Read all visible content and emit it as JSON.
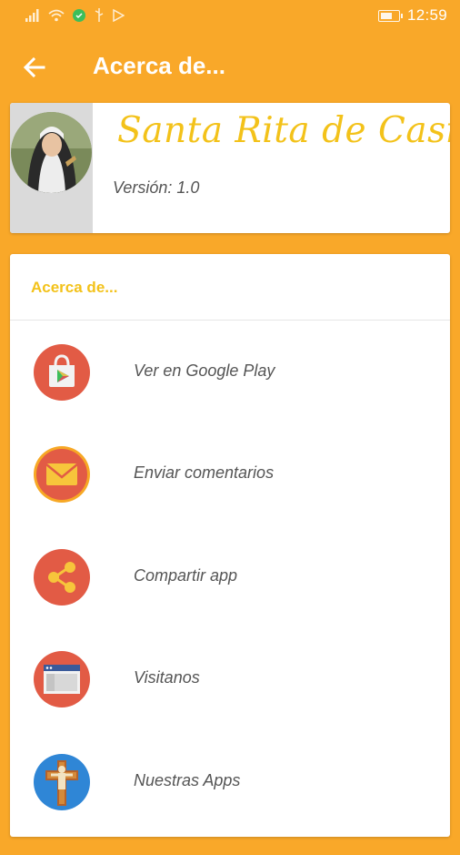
{
  "status_bar": {
    "time": "12:59"
  },
  "app_bar": {
    "title": "Acerca de..."
  },
  "header": {
    "app_name": "Santa Rita de Casia",
    "version": "Versión: 1.0"
  },
  "menu": {
    "section_title": "Acerca de...",
    "items": [
      {
        "label": "Ver en Google Play",
        "icon": "google-play-icon"
      },
      {
        "label": "Enviar comentarios",
        "icon": "envelope-icon"
      },
      {
        "label": "Compartir app",
        "icon": "share-icon"
      },
      {
        "label": "Visitanos",
        "icon": "browser-window-icon"
      },
      {
        "label": "Nuestras Apps",
        "icon": "crucifix-icon"
      }
    ]
  },
  "colors": {
    "primary": "#F9A829",
    "accent": "#F3C21A",
    "icon_red": "#E25B45",
    "icon_blue": "#2F86D6"
  }
}
